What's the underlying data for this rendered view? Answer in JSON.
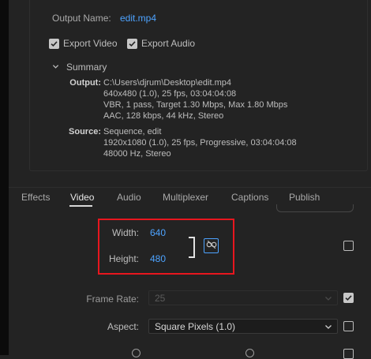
{
  "output_name": {
    "label": "Output Name:",
    "value": "edit.mp4"
  },
  "export_video": {
    "label": "Export Video",
    "checked": true
  },
  "export_audio": {
    "label": "Export Audio",
    "checked": true
  },
  "summary": {
    "title": "Summary",
    "output_key": "Output:",
    "output_lines": [
      "C:\\Users\\djrum\\Desktop\\edit.mp4",
      "640x480 (1.0), 25 fps, 03:04:04:08",
      "VBR, 1 pass, Target 1.30 Mbps, Max 1.80 Mbps",
      "AAC, 128 kbps, 44 kHz, Stereo"
    ],
    "source_key": "Source:",
    "source_lines": [
      "Sequence, edit",
      "1920x1080 (1.0), 25 fps, Progressive, 03:04:04:08",
      "48000 Hz, Stereo"
    ]
  },
  "tabs": [
    {
      "label": "Effects",
      "active": false
    },
    {
      "label": "Video",
      "active": true
    },
    {
      "label": "Audio",
      "active": false
    },
    {
      "label": "Multiplexer",
      "active": false
    },
    {
      "label": "Captions",
      "active": false
    },
    {
      "label": "Publish",
      "active": false
    }
  ],
  "video": {
    "width_label": "Width:",
    "width_value": "640",
    "height_label": "Height:",
    "height_value": "480",
    "frame_rate_label": "Frame Rate:",
    "frame_rate_value": "25",
    "aspect_label": "Aspect:",
    "aspect_value": "Square Pixels (1.0)"
  },
  "colors": {
    "accent": "#4da3ff",
    "highlight": "#e8161e",
    "background": "#232323"
  }
}
